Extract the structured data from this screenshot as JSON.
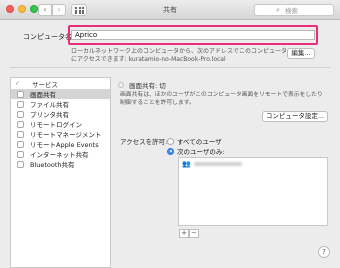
{
  "window": {
    "title": "共有"
  },
  "toolbar": {
    "back_glyph": "‹",
    "forward_glyph": "›",
    "search_placeholder": "検索",
    "search_icon": "search-icon"
  },
  "computer_name": {
    "label": "コンピュータ名:",
    "value": "Aprico",
    "description": "ローカルネットワーク上のコンピュータから、次のアドレスでこのコンピュータにアクセスできます: kuratamio-no-MacBook-Pro.local",
    "edit_label": "編集..."
  },
  "services": {
    "header_check": "✓",
    "header": "サービス",
    "items": [
      {
        "label": "画面共有",
        "selected": true
      },
      {
        "label": "ファイル共有",
        "selected": false
      },
      {
        "label": "プリンタ共有",
        "selected": false
      },
      {
        "label": "リモートログイン",
        "selected": false
      },
      {
        "label": "リモートマネージメント",
        "selected": false
      },
      {
        "label": "リモートApple Events",
        "selected": false
      },
      {
        "label": "インターネット共有",
        "selected": false
      },
      {
        "label": "Bluetooth共有",
        "selected": false
      }
    ]
  },
  "detail": {
    "status": "画面共有: 切",
    "description": "画面共有は、ほかのユーザがこのコンピュータ画面をリモートで表示をしたり制御することを許可します。",
    "settings_label": "コンピュータ設定...",
    "access_label": "アクセスを許可:",
    "radio_all": "すべてのユーザ",
    "radio_these": "次のユーザのみ:",
    "user_icon": "group-icon",
    "add_label": "+",
    "remove_label": "−"
  },
  "help": {
    "label": "?"
  },
  "colors": {
    "highlight_border": "#e8307a",
    "radio_on": "#3c8ef6"
  }
}
